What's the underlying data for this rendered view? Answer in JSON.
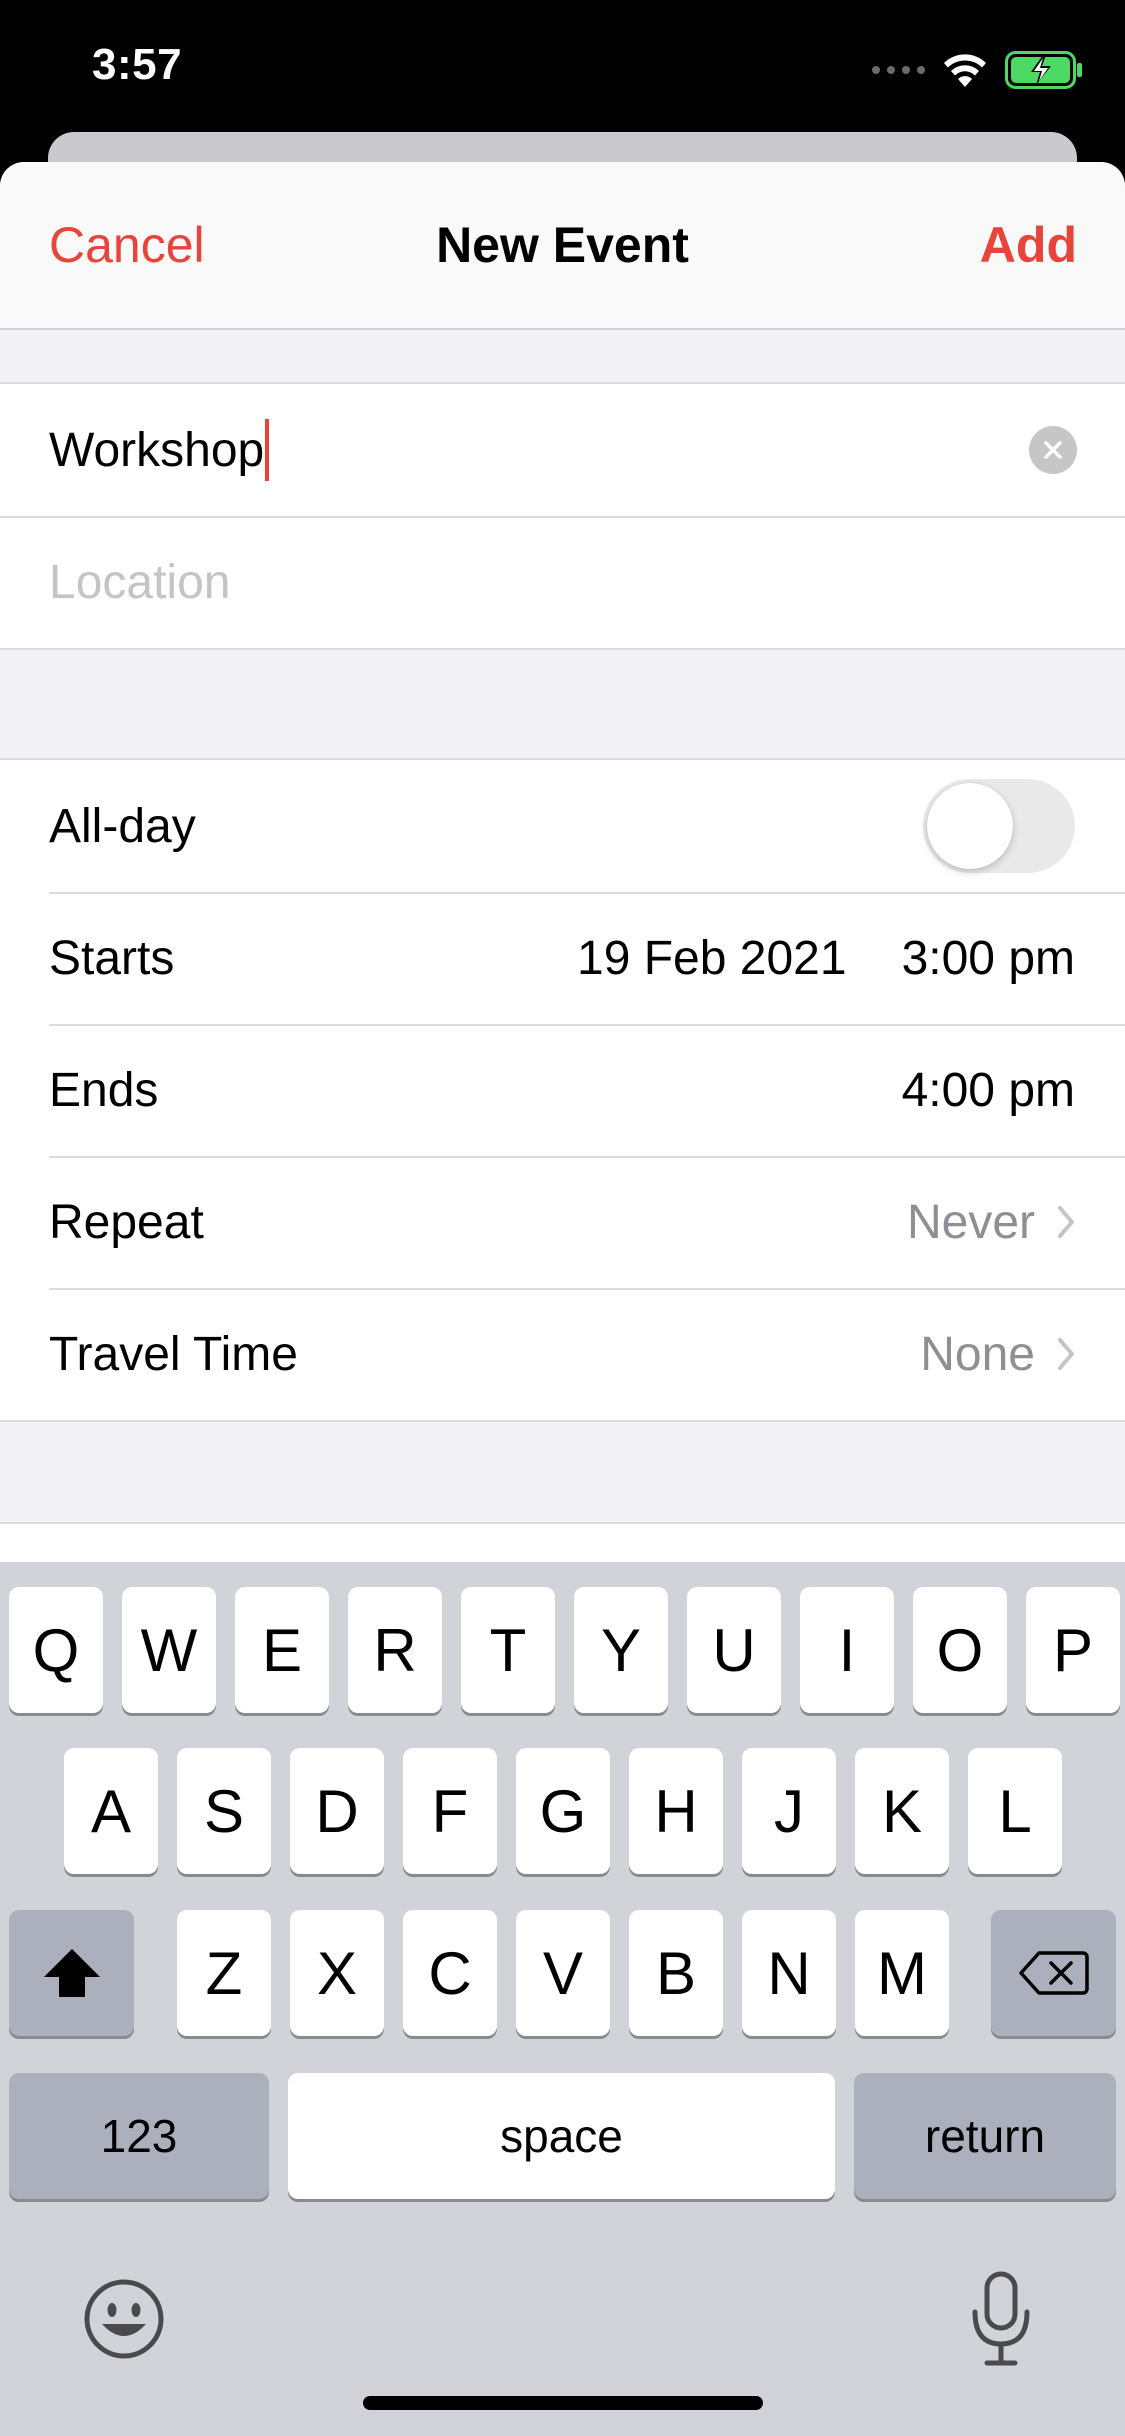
{
  "status_bar": {
    "time": "3:57"
  },
  "nav": {
    "cancel_label": "Cancel",
    "title": "New Event",
    "add_label": "Add"
  },
  "title_field": {
    "value": "Workshop"
  },
  "location_field": {
    "placeholder": "Location"
  },
  "rows": {
    "all_day": {
      "label": "All-day",
      "toggle_on": false
    },
    "starts": {
      "label": "Starts",
      "date": "19 Feb 2021",
      "time": "3:00 pm"
    },
    "ends": {
      "label": "Ends",
      "time": "4:00 pm"
    },
    "repeat": {
      "label": "Repeat",
      "value": "Never"
    },
    "travel_time": {
      "label": "Travel Time",
      "value": "None"
    }
  },
  "keyboard": {
    "row1": [
      "Q",
      "W",
      "E",
      "R",
      "T",
      "Y",
      "U",
      "I",
      "O",
      "P"
    ],
    "row2": [
      "A",
      "S",
      "D",
      "F",
      "G",
      "H",
      "J",
      "K",
      "L"
    ],
    "row3": [
      "Z",
      "X",
      "C",
      "V",
      "B",
      "N",
      "M"
    ],
    "numbers_label": "123",
    "space_label": "space",
    "return_label": "return"
  },
  "colors": {
    "accent": "#e8443a",
    "battery": "#4cd964"
  },
  "icons": [
    "wifi-icon",
    "battery-charging-icon",
    "clear-icon",
    "chevron-right-icon",
    "shift-icon",
    "backspace-icon",
    "emoji-icon",
    "microphone-icon"
  ]
}
